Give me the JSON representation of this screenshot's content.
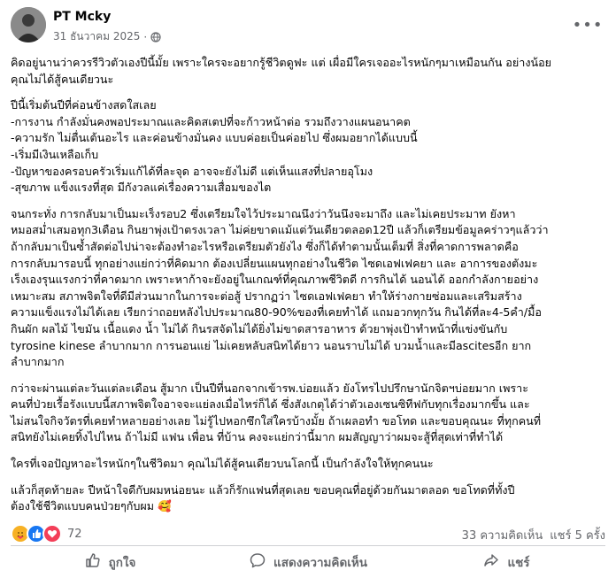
{
  "post": {
    "author": "PT Mcky",
    "date": "31 ธันวาคม 2025",
    "privacy_icon": "globe-icon",
    "more_icon": "more-horizontal-icon",
    "paragraphs": [
      [
        "คิดอยู่นานว่าควรรีวิวตัวเองปีนี้มั้ย เพราะใครจะอยากรู้ชีวิตดูฟะ แต่ เผื่อมีใครเจออะไรหนักๆมาเหมือนกัน อย่างน้อย",
        "คุณไม่ได้สู้คนเดียวนะ"
      ],
      [
        "ปีนี้เริ่มต้นปีที่ค่อนข้างสดใสเลย",
        "-การงาน กำลังมั่นคงพอประมาณและคิดสเตปที่จะก้าวหน้าต่อ รวมถึงวางแผนอนาคต",
        "-ความรัก ไม่ตื่นเต้นอะไร และค่อนข้างมั่นคง แบบค่อยเป็นค่อยไป ซึ่งผมอยากได้แบบนี้",
        "-เริ่มมีเงินเหลือเก็บ",
        "-ปัญหาของครอบครัวเริ่มแก้ได้ที่ละจุด อาจจะยังไม่ดี แต่เห็นแสงที่ปลายอุโมง",
        "-สุขภาพ แข็งแรงที่สุด มีกังวลแค่เรื่องความเสื่อมของไต"
      ],
      [
        "จนกระทั่ง การกลับมาเป็นมะเร็งรอบ2 ซึ่งเตรียมใจไว้ประมาณนึงว่าวันนึงจะมาถึง และไม่เคยประมาท ยังหา",
        "หมอสม่ำเสมอทุก3เดือน กินยาพุ่งเป้าตรงเวลา ไม่ค่ยขาดแม้แต่วันเดียวตลอด12ปี แล้วก็เตรียมข้อมูลคร่าวๆแล้วว่า",
        "ถ้ากลับมาเป็นซ้ำสัดต่อไปน่าจะต้องทำอะไรหรือเตรียมตัวยังไง ซึ่งก็ได้ทำตามนั้นเต็มที่ สิ่งที่คาดการพลาดคือ",
        "การกลับมารอบนี้ ทุกอย่างแย่กว่าที่คิดมาก ต้องเปลี่ยนแผนทุกอย่างในชีวิต ไซดเอฟเฟคยา และ อาการของตังมะ",
        "เร็งเองรุนแรงกว่าที่คาดมาก เพราะหาก้าจะยังอยู่ในเกณฑ์ที่คุณภาพชีวิตดี การกินได้ นอนได้ ออกกำลังกายอย่าง",
        "เหมาะสม สภาพจิตใจที่ดีมีส่วนมากในการจะต่อสู้ ปรากฏว่า ไซดเอฟเฟคยา ทำให้ร่างกายซ่อมและเสริมสร้าง",
        "ความแข็งแรงไม่ได้เลย เรียกว่าถอยหลังไปประมาณ80-90%ของที่เคยทำได้ แถมอวกทุกวัน กินได้ที่ละ4-5คำ/มื้อ",
        "กินผัก ผลไม้ ไขมัน เนื้อแดง น้ำ ไม่ได้ กินรสจัดไม่ได้ยิ่งไม่ขาดสารอาหาร ด้วยาพุ่งเป้าทำหน้าที่แข่งขันกับ",
        "tyrosine kinese ลำบากมาก การนอนแย่ ไม่เคยหลับสนิทได้ยาว นอนราบไม่ได้ บวมน้ำและมีascitesอีก ยาก",
        "ลำบากมาก"
      ],
      [
        "กว่าจะผ่านแต่ละวันแต่ละเดือน สู้มาก เป็นปีที่นอกจากเข้ารพ.บ่อยแล้ว ยังโทรไปปรึกษานักจิตฯบ่อยมาก เพราะ",
        "คนที่ป่วยเรื้อรังแบบนี้สภาพจิตใจอาจจะแย่ลงเมื่อไหร่ก็ได้ ซึ่งสังเกตุได้ว่าตัวเองเซนซิทีฟกับทุกเรื่องมากขึ้น และ",
        "ไม่สนใจกิจวัตรที่เคยทำหลายอย่างเลย ไม่รู้ไปหอกซึกใส่ใครบ้างมั้ย ถ้าเผลอทำ ขอโทด และขอบคุณนะ ที่ทุกคนที่",
        "สนิทยังไม่เคยทิ้งไปไหน ถ้าไม่มี แฟน เพื่อน ที่บ้าน คงจะแย่กว่านี้มาก ผมสัญญาว่าผมจะสู้ที่สุดเท่าที่ทำได้"
      ],
      [
        "ใครที่เจอปัญหาอะไรหนักๆในชีวิตมา คุณไม่ได้สู้คนเดียวบนโลกนี้ เป็นกำลังใจให้ทุกคนนะ"
      ],
      [
        "แล้วก็สุดท้ายละ ปีหน้าใจดีกับผมหน่อยนะ แล้วก็รักแฟนที่สุดเลย ขอบคุณที่อยู่ด้วยกันมาตลอด ขอโทดที่ทั้งปี",
        "ต้องใช้ชีวิตแบบคนป่วยๆกับผม 🥰"
      ]
    ]
  },
  "stats": {
    "reaction_count": "72",
    "reaction_icons": [
      "care-reaction-icon",
      "like-reaction-icon",
      "love-reaction-icon"
    ],
    "comments": "33 ความคิดเห็น",
    "shares": "แชร์ 5 ครั้ง"
  },
  "actions": {
    "like": "ถูกใจ",
    "comment": "แสดงความคิดเห็น",
    "share": "แชร์"
  },
  "colors": {
    "text": "#050505",
    "secondary": "#65676b",
    "like_blue": "#1877f2",
    "love_red": "#f33e58",
    "care_yellow": "#f7b125"
  }
}
